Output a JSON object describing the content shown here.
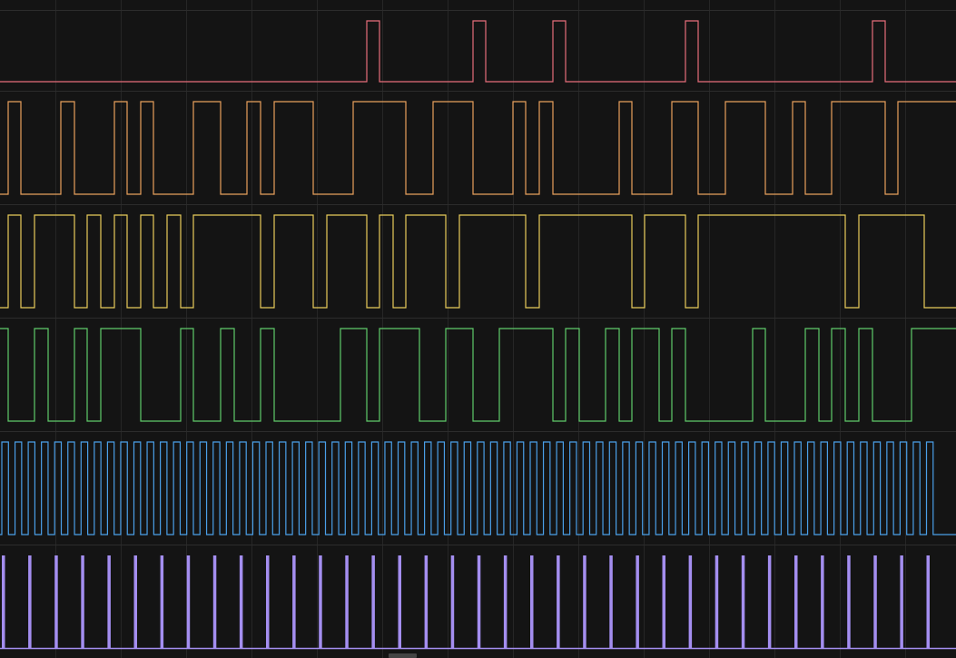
{
  "colors": {
    "background": "#141414",
    "row_border": "#2c2c2c",
    "grid": "#262626",
    "scrollbar_thumb": "#444444"
  },
  "channels": [
    {
      "id": "ch1",
      "color": "#e66d7a",
      "edges": [
        0,
        404,
        418,
        521,
        535,
        609,
        623,
        755,
        769,
        961,
        975,
        1053
      ],
      "initial": 0
    },
    {
      "id": "ch2",
      "color": "#e8a05c",
      "edges": [
        0,
        9,
        23,
        67,
        82,
        126,
        140,
        155,
        169,
        213,
        243,
        272,
        287,
        302,
        345,
        389,
        447,
        477,
        521,
        565,
        579,
        594,
        609,
        682,
        696,
        740,
        769,
        799,
        843,
        873,
        887,
        916,
        975,
        989,
        1053
      ],
      "initial": 0
    },
    {
      "id": "ch3",
      "color": "#e8cc5a",
      "edges": [
        0,
        9,
        23,
        38,
        82,
        96,
        111,
        126,
        140,
        155,
        169,
        184,
        199,
        213,
        287,
        302,
        345,
        360,
        404,
        418,
        433,
        447,
        491,
        506,
        579,
        594,
        696,
        710,
        755,
        769,
        931,
        946,
        1018,
        1053
      ],
      "initial": 0
    },
    {
      "id": "ch4",
      "color": "#5fcc6a",
      "edges": [
        0,
        9,
        38,
        53,
        82,
        96,
        111,
        155,
        199,
        213,
        243,
        258,
        287,
        302,
        375,
        404,
        418,
        462,
        491,
        521,
        550,
        609,
        623,
        638,
        667,
        682,
        696,
        726,
        740,
        755,
        829,
        843,
        887,
        902,
        916,
        931,
        946,
        961,
        1004,
        1053
      ],
      "initial": 1
    },
    {
      "id": "ch5",
      "color": "#4a9fe8",
      "type": "clock",
      "start": 2,
      "period": 14.55,
      "high_width": 7.3,
      "cycles": 71
    },
    {
      "id": "ch6",
      "color": "#a48ef0",
      "type": "pulse",
      "start": 2,
      "period": 29.1,
      "pulse_width": 3.5,
      "pulses": 36
    }
  ]
}
